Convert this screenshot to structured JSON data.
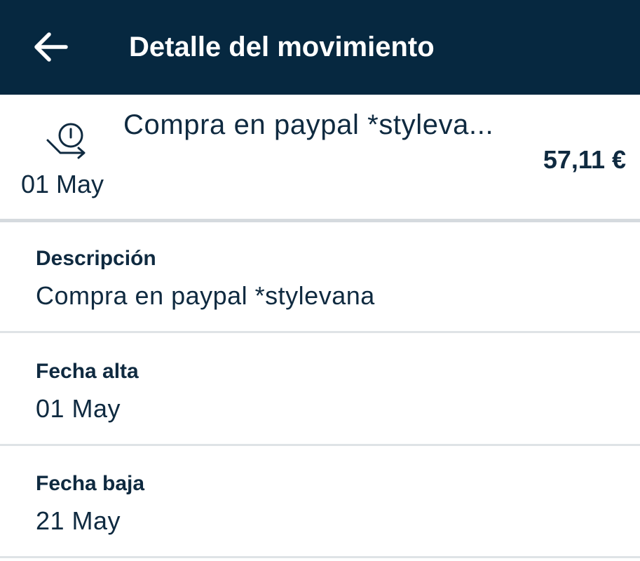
{
  "app_bar": {
    "title": "Detalle del movimiento",
    "back_icon": "arrow-left-icon",
    "background_color": "#062840"
  },
  "summary": {
    "icon": "clock-return-icon",
    "title": "Compra en paypal *styleva...",
    "amount": "57,11 €",
    "date": "01 May"
  },
  "details": [
    {
      "label": "Descripción",
      "value": "Compra en paypal *stylevana"
    },
    {
      "label": "Fecha alta",
      "value": "01 May"
    },
    {
      "label": "Fecha baja",
      "value": "21 May"
    }
  ]
}
